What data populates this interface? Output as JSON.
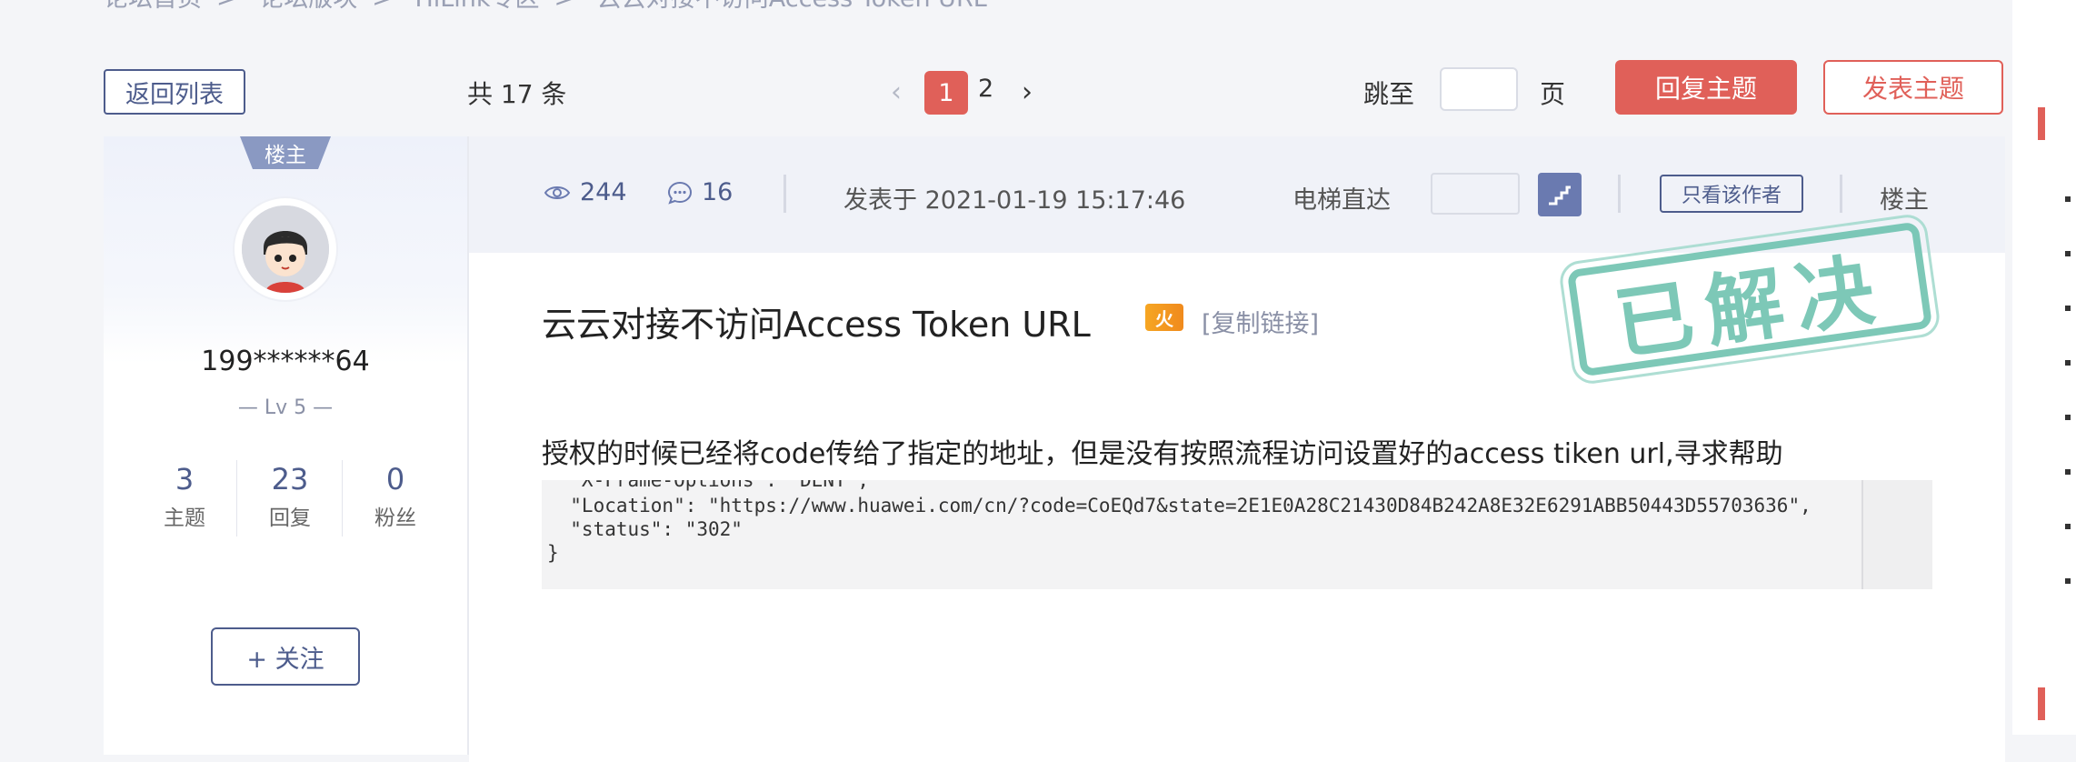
{
  "breadcrumb": [
    "论坛首页",
    "论坛版块",
    "HiLink专区",
    "云云对接不访问Access Token URL"
  ],
  "toolbar": {
    "back_label": "返回列表",
    "total": "共 17 条",
    "pages": [
      "1",
      "2"
    ],
    "current_page": "1",
    "jump_label": "跳至",
    "jump_suffix": "页",
    "reply_label": "回复主题",
    "post_label": "发表主题"
  },
  "author": {
    "tag": "楼主",
    "name": "199******64",
    "level": "— Lv 5 —",
    "stats": [
      {
        "value": "3",
        "label": "主题"
      },
      {
        "value": "23",
        "label": "回复"
      },
      {
        "value": "0",
        "label": "粉丝"
      }
    ],
    "follow_label": "+ 关注"
  },
  "meta": {
    "views": "244",
    "comments": "16",
    "posted": "发表于 2021-01-19 15:17:46",
    "elevator_label": "电梯直达",
    "only_author": "只看该作者",
    "floor": "楼主"
  },
  "post": {
    "title": "云云对接不访问Access Token URL",
    "badge": "火",
    "copy_link": "[复制链接]",
    "stamp": "已解决",
    "text": "授权的时候已经将code传给了指定的地址，但是没有按照流程访问设置好的access tiken url,寻求帮助",
    "code_lines": [
      "  \"X-Frame-Options\": \"DENY\",",
      "  \"Location\": \"https://www.huawei.com/cn/?code=CoEQd7&state=2E1E0A28C21430D84B242A8E32E6291ABB50443D55703636\",",
      "  \"status\": \"302\"",
      "}"
    ]
  },
  "colors": {
    "accent_red": "#e06059",
    "primary_blue": "#4d5c8c",
    "stamp_green": "#6fc3b0"
  }
}
